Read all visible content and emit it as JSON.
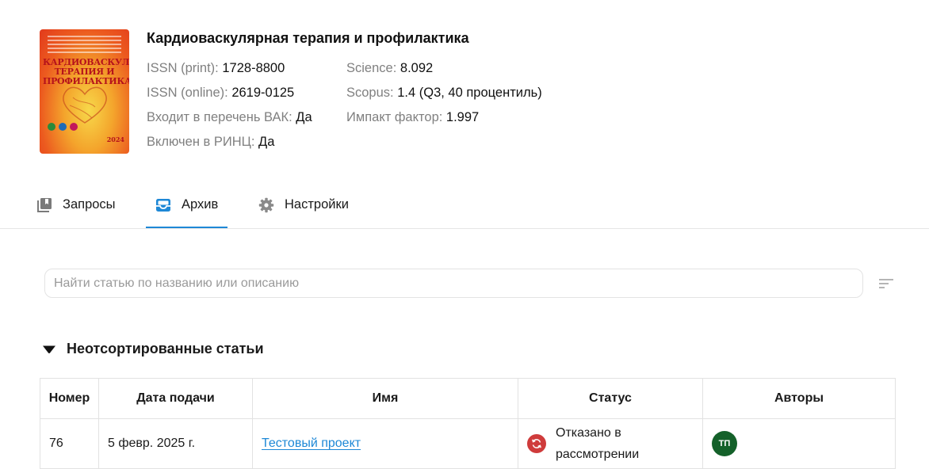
{
  "journal": {
    "title": "Кардиоваскулярная терапия и профилактика",
    "cover": {
      "title_line1": "КАРДИОВАСКУЛЯРНАЯ",
      "title_line2": "ТЕРАПИЯ И ПРОФИЛАКТИКА",
      "year": "2024"
    },
    "meta": [
      {
        "key": "ISSN (print):",
        "value": "1728-8800"
      },
      {
        "key": "ISSN (online):",
        "value": "2619-0125"
      },
      {
        "key": "Входит в перечень ВАК:",
        "value": "Да"
      },
      {
        "key": "Включен в РИНЦ:",
        "value": "Да"
      },
      {
        "key": "Science:",
        "value": "8.092"
      },
      {
        "key": "Scopus:",
        "value": "1.4 (Q3, 40 процентиль)"
      },
      {
        "key": "Импакт фактор:",
        "value": "1.997"
      }
    ]
  },
  "tabs": [
    {
      "label": "Запросы",
      "icon": "requests-icon"
    },
    {
      "label": "Архив",
      "icon": "archive-icon",
      "active": true
    },
    {
      "label": "Настройки",
      "icon": "gear-icon"
    }
  ],
  "search": {
    "placeholder": "Найти статью по названию или описанию",
    "value": ""
  },
  "group": {
    "title": "Неотсортированные статьи",
    "expanded": true
  },
  "table": {
    "headers": [
      "Номер",
      "Дата подачи",
      "Имя",
      "Статус",
      "Авторы"
    ],
    "rows": [
      {
        "number": "76",
        "date": "5 февр. 2025 г.",
        "name": "Тестовый проект",
        "status": "Отказано в рассмотрении",
        "status_color": "#cf3b3b",
        "author_initials": "ТП",
        "author_color": "#14612a"
      }
    ]
  },
  "colors": {
    "accent": "#1e88d6"
  }
}
